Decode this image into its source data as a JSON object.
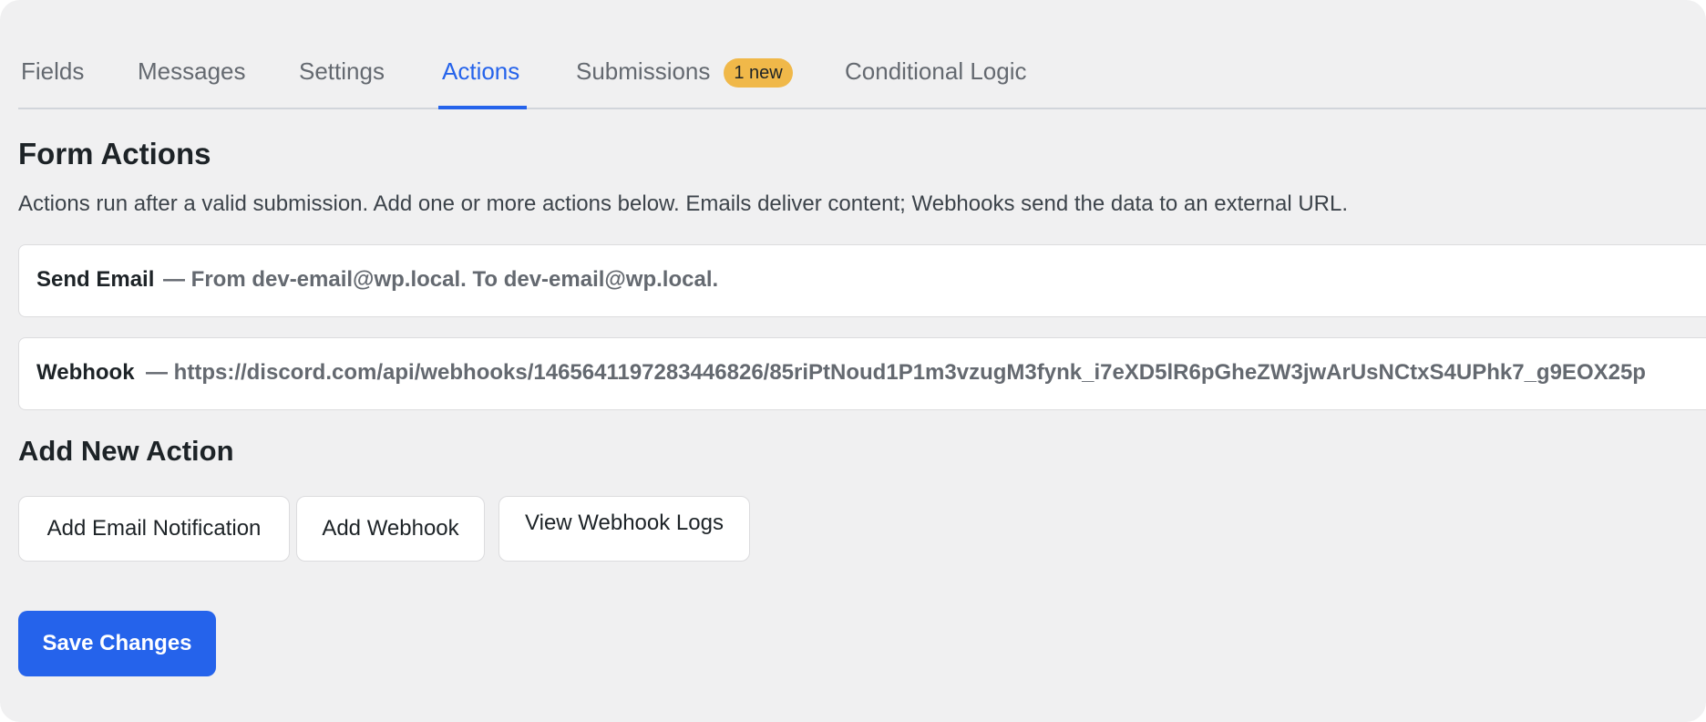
{
  "tabs": [
    {
      "label": "Fields"
    },
    {
      "label": "Messages"
    },
    {
      "label": "Settings"
    },
    {
      "label": "Actions",
      "active": true
    },
    {
      "label": "Submissions",
      "badge": "1 new"
    },
    {
      "label": "Conditional Logic"
    }
  ],
  "page": {
    "title": "Form Actions",
    "description": "Actions run after a valid submission. Add one or more actions below. Emails deliver content; Webhooks send the data to an external URL."
  },
  "actions": [
    {
      "type": "Send Email",
      "detail": "— From dev-email@wp.local. To dev-email@wp.local."
    },
    {
      "type": "Webhook",
      "detail": "— https://discord.com/api/webhooks/1465641197283446826/85riPtNoud1P1m3vzugM3fynk_i7eXD5lR6pGheZW3jwArUsNCtxS4UPhk7_g9EOX25p"
    }
  ],
  "add_section": {
    "title": "Add New Action",
    "buttons": {
      "add_email": "Add Email Notification",
      "add_webhook": "Add Webhook",
      "view_logs": "View Webhook Logs"
    }
  },
  "save_label": "Save Changes",
  "colors": {
    "accent": "#2563eb",
    "badge": "#f0b849",
    "background": "#f0f0f1"
  }
}
